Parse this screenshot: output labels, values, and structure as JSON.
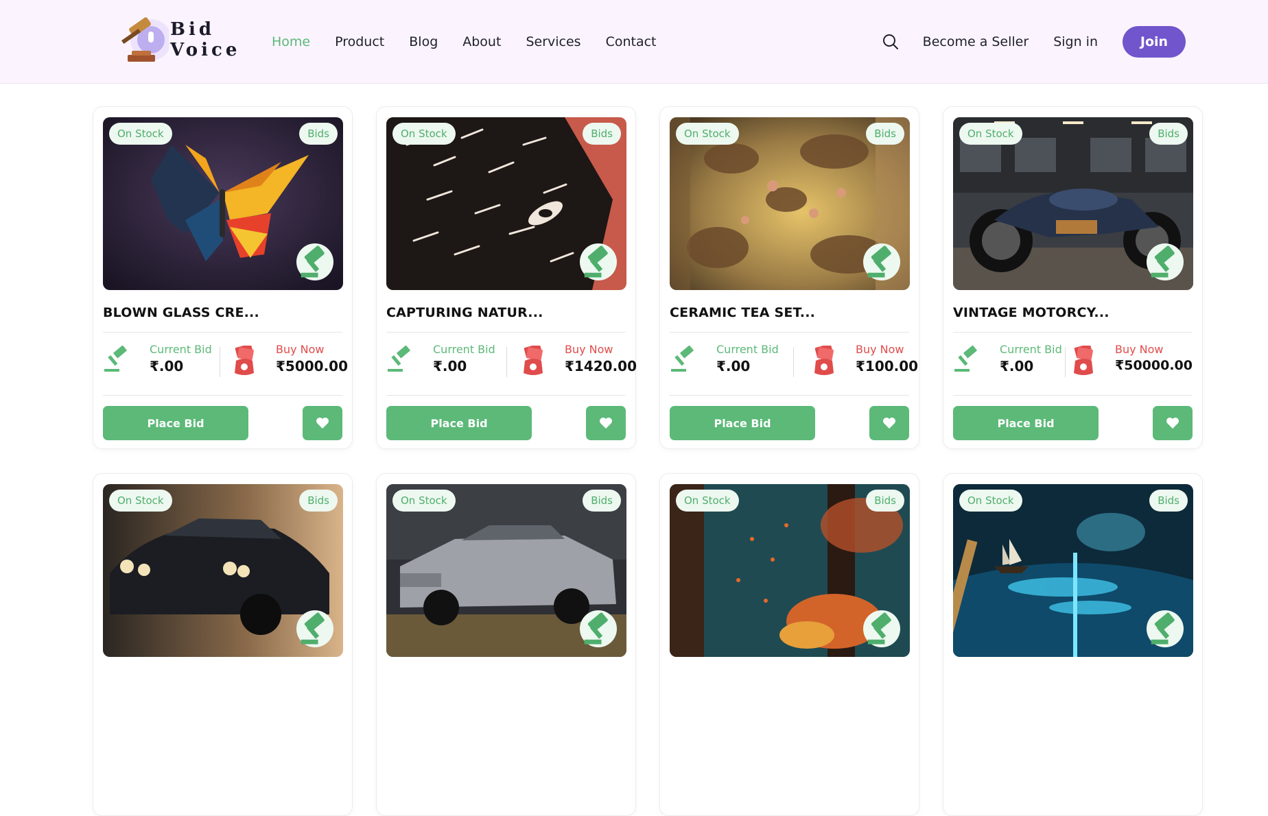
{
  "header": {
    "logo_text_line1": "Bid",
    "logo_text_line2": "Voice",
    "nav": [
      "Home",
      "Product",
      "Blog",
      "About",
      "Services",
      "Contact"
    ],
    "active_nav": "Home",
    "become_seller": "Become a Seller",
    "sign_in": "Sign in",
    "join": "Join"
  },
  "colors": {
    "accent_green": "#5cb978",
    "buy_red": "#e04b4b",
    "join_purple": "#7155cc",
    "header_bg": "#fbf4fe"
  },
  "labels": {
    "on_stock": "On Stock",
    "bids": "Bids",
    "current_bid": "Current Bid",
    "buy_now": "Buy Now",
    "place_bid": "Place Bid"
  },
  "products": [
    {
      "title": "BLOWN GLASS CRE...",
      "current_bid": "₹.00",
      "buy_now": "₹5000.00",
      "image": "butterfly"
    },
    {
      "title": "CAPTURING NATUR...",
      "current_bid": "₹.00",
      "buy_now": "₹1420.00",
      "image": "cat-art"
    },
    {
      "title": "CERAMIC TEA SET...",
      "current_bid": "₹.00",
      "buy_now": "₹100.00",
      "image": "fresco"
    },
    {
      "title": "VINTAGE MOTORCY...",
      "current_bid": "₹.00",
      "buy_now": "₹50000.00",
      "image": "motorcycle"
    },
    {
      "title": "",
      "current_bid": "",
      "buy_now": "",
      "image": "muscle-car-black"
    },
    {
      "title": "",
      "current_bid": "",
      "buy_now": "",
      "image": "muscle-car-grey"
    },
    {
      "title": "",
      "current_bid": "",
      "buy_now": "",
      "image": "autumn-forest"
    },
    {
      "title": "",
      "current_bid": "",
      "buy_now": "",
      "image": "ship-in-book"
    }
  ]
}
